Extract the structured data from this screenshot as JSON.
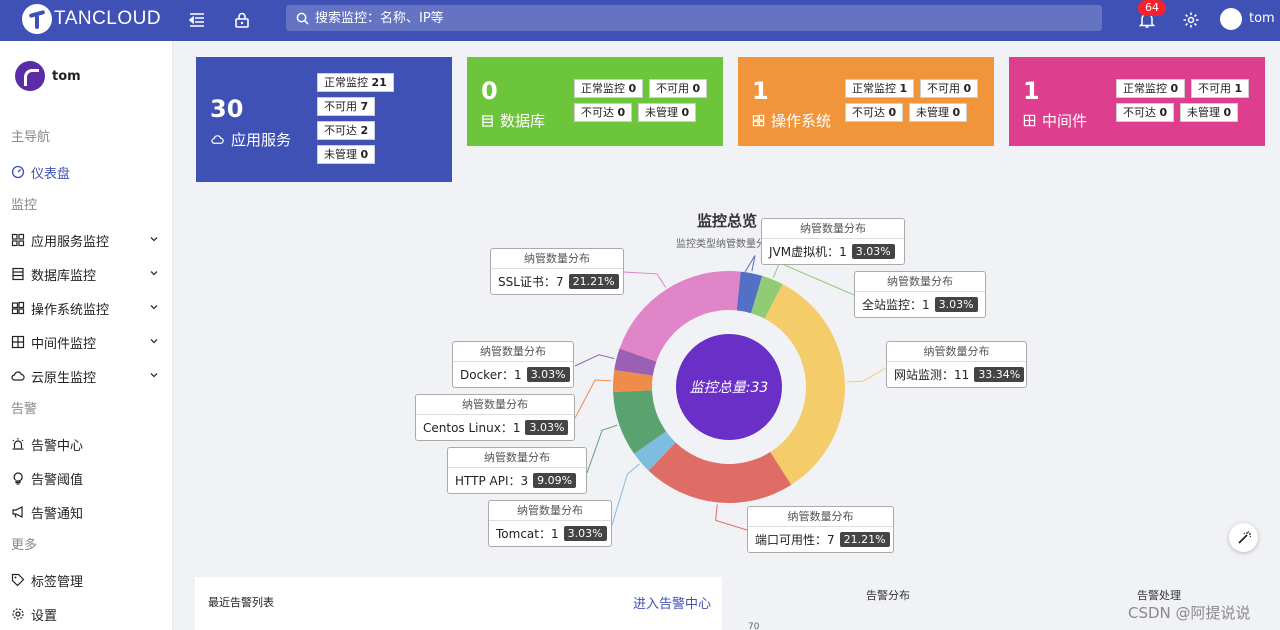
{
  "header": {
    "logo_text": "TANCLOUD",
    "search_placeholder": "搜索监控：名称、IP等",
    "notification_count": "64",
    "username": "tom"
  },
  "sidebar": {
    "username": "tom",
    "groups": [
      {
        "label": "主导航",
        "items": [
          {
            "label": "仪表盘",
            "icon": "dashboard-icon",
            "active": true
          }
        ]
      },
      {
        "label": "监控",
        "items": [
          {
            "label": "应用服务监控",
            "icon": "apps-icon",
            "expandable": true
          },
          {
            "label": "数据库监控",
            "icon": "database-icon",
            "expandable": true
          },
          {
            "label": "操作系统监控",
            "icon": "os-icon",
            "expandable": true
          },
          {
            "label": "中间件监控",
            "icon": "middleware-icon",
            "expandable": true
          },
          {
            "label": "云原生监控",
            "icon": "cloud-icon",
            "expandable": true
          }
        ]
      },
      {
        "label": "告警",
        "items": [
          {
            "label": "告警中心",
            "icon": "alarm-icon"
          },
          {
            "label": "告警阈值",
            "icon": "bulb-icon"
          },
          {
            "label": "告警通知",
            "icon": "megaphone-icon"
          }
        ]
      },
      {
        "label": "更多",
        "items": [
          {
            "label": "标签管理",
            "icon": "tag-icon"
          },
          {
            "label": "设置",
            "icon": "gear-icon"
          }
        ]
      }
    ]
  },
  "cards": [
    {
      "count": "30",
      "name": "应用服务",
      "icon": "cloud-icon",
      "color": "#3f51b5",
      "tags": [
        {
          "label": "正常监控",
          "value": "21"
        },
        {
          "label": "不可用",
          "value": "7"
        },
        {
          "label": "不可达",
          "value": "2"
        },
        {
          "label": "未管理",
          "value": "0"
        }
      ]
    },
    {
      "count": "0",
      "name": "数据库",
      "icon": "database-icon",
      "color": "#6dc53b",
      "tags": [
        {
          "label": "正常监控",
          "value": "0"
        },
        {
          "label": "不可用",
          "value": "0"
        },
        {
          "label": "不可达",
          "value": "0"
        },
        {
          "label": "未管理",
          "value": "0"
        }
      ]
    },
    {
      "count": "1",
      "name": "操作系统",
      "icon": "os-icon",
      "color": "#f0953c",
      "tags": [
        {
          "label": "正常监控",
          "value": "1"
        },
        {
          "label": "不可用",
          "value": "0"
        },
        {
          "label": "不可达",
          "value": "0"
        },
        {
          "label": "未管理",
          "value": "0"
        }
      ]
    },
    {
      "count": "1",
      "name": "中间件",
      "icon": "middleware-icon",
      "color": "#de3e8e",
      "tags": [
        {
          "label": "正常监控",
          "value": "0"
        },
        {
          "label": "不可用",
          "value": "1"
        },
        {
          "label": "不可达",
          "value": "0"
        },
        {
          "label": "未管理",
          "value": "0"
        }
      ]
    }
  ],
  "chart_data": {
    "type": "pie",
    "title": "监控总览",
    "subtitle": "监控类型纳管数量分布",
    "center_label": "监控总量:33",
    "tooltip_title": "纳管数量分布",
    "slices": [
      {
        "name": "JVM虚拟机",
        "value": 1,
        "percent": "3.03%",
        "color": "#5470c6"
      },
      {
        "name": "全站监控",
        "value": 1,
        "percent": "3.03%",
        "color": "#91cc75"
      },
      {
        "name": "网站监测",
        "value": 11,
        "percent": "33.34%",
        "color": "#f4cd6a"
      },
      {
        "name": "端口可用性",
        "value": 7,
        "percent": "21.21%",
        "color": "#e06c66"
      },
      {
        "name": "Tomcat",
        "value": 1,
        "percent": "3.03%",
        "color": "#7fbde0"
      },
      {
        "name": "HTTP API",
        "value": 3,
        "percent": "9.09%",
        "color": "#5aa370"
      },
      {
        "name": "Centos Linux",
        "value": 1,
        "percent": "3.03%",
        "color": "#f08c4a"
      },
      {
        "name": "Docker",
        "value": 1,
        "percent": "3.03%",
        "color": "#9a60b4"
      },
      {
        "name": "SSL证书",
        "value": 7,
        "percent": "21.21%",
        "color": "#e085c8"
      }
    ]
  },
  "bottom": {
    "alert_list_title": "最近告警列表",
    "alert_center_link": "进入告警中心",
    "alert_distribution_title": "告警分布",
    "alert_handling_title": "告警处理",
    "axis_tick": "70"
  },
  "watermark": "CSDN @阿提说说"
}
